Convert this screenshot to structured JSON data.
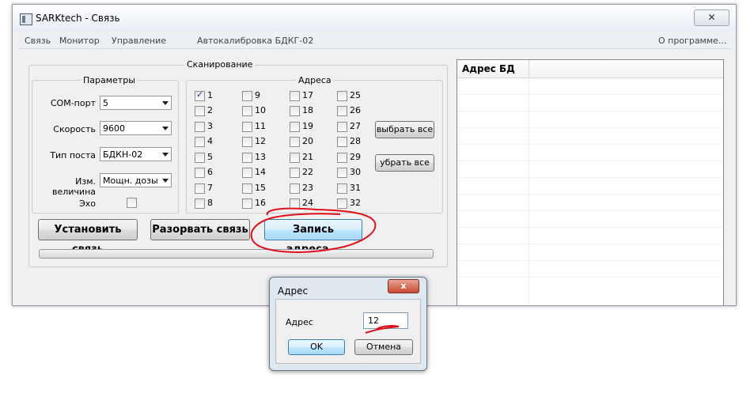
{
  "window": {
    "title": "SARKtech - Связь",
    "close_glyph": "✕"
  },
  "menu": [
    "Связь",
    "Монитор",
    "Управление",
    "Автокалибровка БДКГ-02",
    "О программе..."
  ],
  "scan": {
    "title": "Сканирование",
    "params": {
      "title": "Параметры",
      "com_label": "COM-порт",
      "com_value": "5",
      "speed_label": "Скорость",
      "speed_value": "9600",
      "post_label": "Тип поста",
      "post_value": "БДКН-02",
      "meas_label": "Изм. величина",
      "meas_value": "Мощн. дозы",
      "echo_label": "Эхо"
    },
    "addresses": {
      "title": "Адреса",
      "items": [
        "1",
        "2",
        "3",
        "4",
        "5",
        "6",
        "7",
        "8",
        "9",
        "10",
        "11",
        "12",
        "13",
        "14",
        "15",
        "16",
        "17",
        "18",
        "19",
        "20",
        "21",
        "22",
        "23",
        "24",
        "25",
        "26",
        "27",
        "28",
        "29",
        "30",
        "31",
        "32"
      ],
      "checked": [
        "1"
      ],
      "select_all": "выбрать все",
      "deselect_all": "убрать все"
    }
  },
  "buttons": {
    "connect": "Установить связь",
    "disconnect": "Разорвать связь",
    "write_address": "Запись адреса..."
  },
  "table": {
    "header": "Адрес БД"
  },
  "dialog": {
    "title": "Адрес",
    "label": "Адрес",
    "value": "12",
    "ok": "OK",
    "cancel": "Отмена",
    "close_glyph": "x"
  },
  "annotation_color": "#e0101a"
}
